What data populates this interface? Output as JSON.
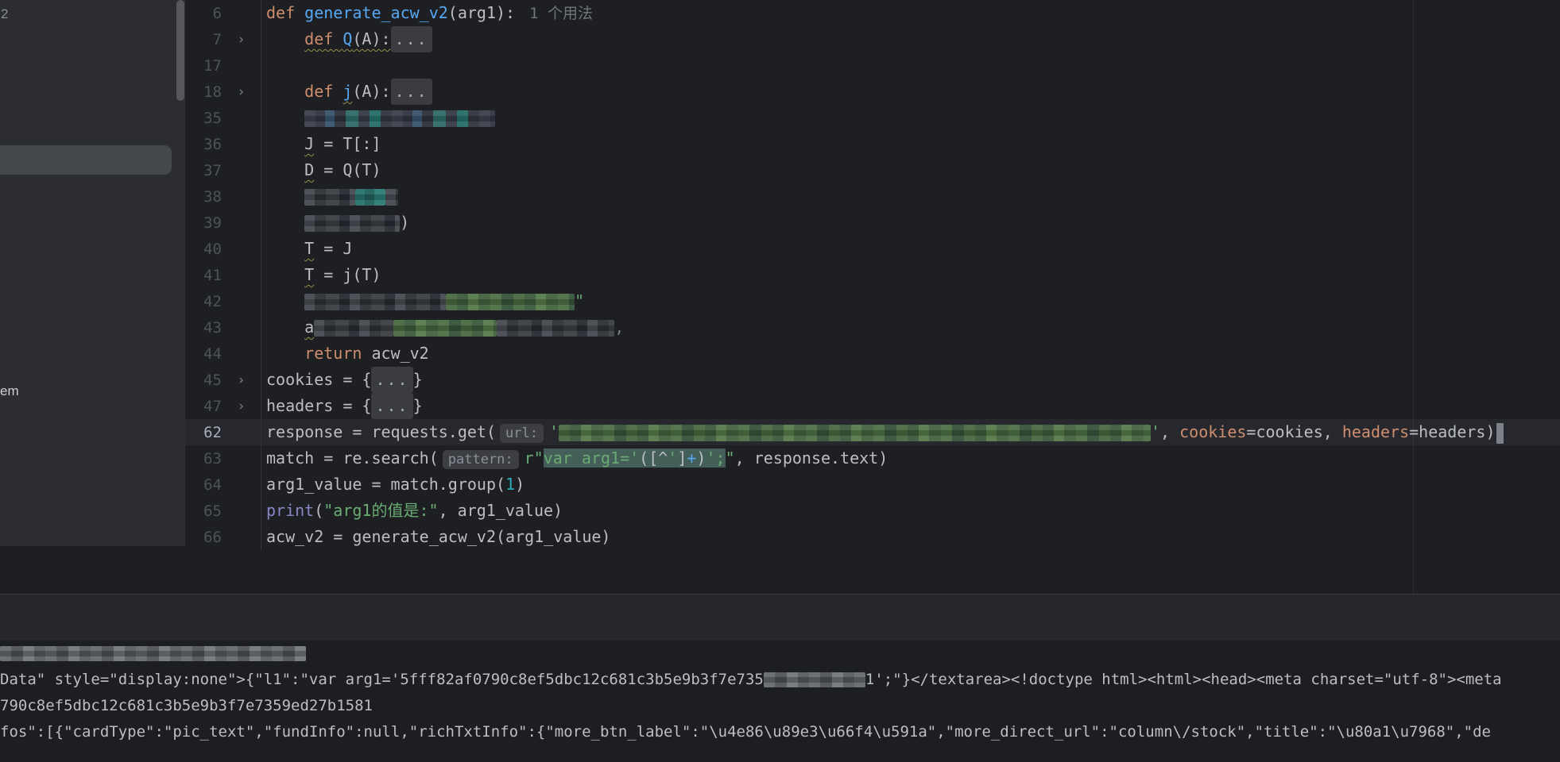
{
  "colors": {
    "editor_bg": "#1e1f22",
    "sidebar_bg": "#2b2d30",
    "current_line_bg": "#26282e",
    "keyword_orange": "#cf8e6d",
    "function_blue": "#56a8f5",
    "string_green": "#6aab73",
    "number_cyan": "#2aacb8",
    "builtin_purple": "#8888c6",
    "plain_text": "#bcbec4",
    "line_number_gray": "#4d525b",
    "selection_teal": "#445e58",
    "warning_squiggle": "#97904c"
  },
  "sidebar": {
    "top_partial_label": "2",
    "partial_item_label": "em"
  },
  "editor": {
    "usage_hint": "1 个用法",
    "lines": [
      {
        "num": "6",
        "arrow": false,
        "cur": false,
        "segs": [
          [
            "kw",
            "def "
          ],
          [
            "fn",
            "generate_acw_v2"
          ],
          [
            "pl",
            "(arg1):"
          ],
          [
            "hint",
            "1 个用法"
          ]
        ]
      },
      {
        "num": "7",
        "arrow": true,
        "cur": false,
        "segs": [
          [
            "pl",
            "    "
          ],
          [
            "kw",
            "def ",
            "sq"
          ],
          [
            "fn",
            "Q",
            "sq"
          ],
          [
            "pl",
            "(A):",
            "sq"
          ],
          [
            "fold",
            "..."
          ]
        ]
      },
      {
        "num": "17",
        "arrow": false,
        "cur": false,
        "segs": []
      },
      {
        "num": "18",
        "arrow": true,
        "cur": false,
        "segs": [
          [
            "pl",
            "    "
          ],
          [
            "kw",
            "def "
          ],
          [
            "fn",
            "j",
            "sq"
          ],
          [
            "pl",
            "(A):"
          ],
          [
            "fold",
            "..."
          ]
        ]
      },
      {
        "num": "35",
        "arrow": false,
        "cur": false,
        "segs": [
          [
            "pl",
            "    "
          ],
          [
            "mz-blue",
            240
          ]
        ]
      },
      {
        "num": "36",
        "arrow": false,
        "cur": false,
        "segs": [
          [
            "pl",
            "    "
          ],
          [
            "pl",
            "J",
            "sq"
          ],
          [
            "pl",
            " = T[:]"
          ]
        ]
      },
      {
        "num": "37",
        "arrow": false,
        "cur": false,
        "segs": [
          [
            "pl",
            "    "
          ],
          [
            "pl",
            "D",
            "sq"
          ],
          [
            "pl",
            " = Q(T)"
          ]
        ]
      },
      {
        "num": "38",
        "arrow": false,
        "cur": false,
        "segs": [
          [
            "pl",
            "    "
          ],
          [
            "mz-gray",
            64
          ],
          [
            "mz-teal",
            38
          ],
          [
            "mz-gray",
            16
          ]
        ]
      },
      {
        "num": "39",
        "arrow": false,
        "cur": false,
        "segs": [
          [
            "pl",
            "    "
          ],
          [
            "mz-gray",
            120
          ],
          [
            "pl",
            ")"
          ]
        ]
      },
      {
        "num": "40",
        "arrow": false,
        "cur": false,
        "segs": [
          [
            "pl",
            "    "
          ],
          [
            "pl",
            "T",
            "sq"
          ],
          [
            "pl",
            " = J"
          ]
        ]
      },
      {
        "num": "41",
        "arrow": false,
        "cur": false,
        "segs": [
          [
            "pl",
            "    "
          ],
          [
            "pl",
            "T",
            "sq"
          ],
          [
            "pl",
            " = j(T)"
          ]
        ]
      },
      {
        "num": "42",
        "arrow": false,
        "cur": false,
        "segs": [
          [
            "pl",
            "    "
          ],
          [
            "mz-gray",
            178
          ],
          [
            "mz-green",
            162
          ],
          [
            "str",
            "\""
          ]
        ]
      },
      {
        "num": "43",
        "arrow": false,
        "cur": false,
        "segs": [
          [
            "pl",
            "    "
          ],
          [
            "pl",
            "a",
            "sq"
          ],
          [
            "mz-gray",
            100
          ],
          [
            "mz-green",
            130
          ],
          [
            "mz-gray",
            148
          ],
          [
            "dim",
            ","
          ]
        ]
      },
      {
        "num": "44",
        "arrow": false,
        "cur": false,
        "segs": [
          [
            "pl",
            "    "
          ],
          [
            "kw",
            "return"
          ],
          [
            "pl",
            " acw_v2"
          ]
        ]
      },
      {
        "num": "45",
        "arrow": true,
        "cur": false,
        "segs": [
          [
            "pl",
            "cookies = {"
          ],
          [
            "fold",
            "..."
          ],
          [
            "pl",
            "}"
          ]
        ]
      },
      {
        "num": "47",
        "arrow": true,
        "cur": false,
        "segs": [
          [
            "pl",
            "headers = {"
          ],
          [
            "fold",
            "..."
          ],
          [
            "pl",
            "}"
          ]
        ]
      },
      {
        "num": "62",
        "arrow": false,
        "cur": true,
        "segs": [
          [
            "pl",
            "response = requests.get("
          ],
          [
            "pill",
            "url:"
          ],
          [
            "str",
            "'"
          ],
          [
            "mz-green",
            745
          ],
          [
            "str",
            "'"
          ],
          [
            "pl",
            ", "
          ],
          [
            "arg",
            "cookies"
          ],
          [
            "pl",
            "=cookies, "
          ],
          [
            "arg",
            "headers"
          ],
          [
            "pl",
            "=headers)"
          ],
          [
            "caret",
            ""
          ]
        ]
      },
      {
        "num": "63",
        "arrow": false,
        "cur": false,
        "segs": [
          [
            "pl",
            "match = re.search("
          ],
          [
            "pill",
            "pattern:"
          ],
          [
            "str",
            "r\""
          ],
          [
            "str",
            "var arg1='",
            "hl"
          ],
          [
            "pl",
            "([^",
            "hl"
          ],
          [
            "str",
            "'",
            "hl"
          ],
          [
            "pl",
            "]",
            "hl"
          ],
          [
            "fn",
            "+",
            "hl"
          ],
          [
            "pl",
            ")",
            "hl"
          ],
          [
            "str",
            "';",
            "hl"
          ],
          [
            "str",
            "\""
          ],
          [
            "pl",
            ", response.text)"
          ]
        ]
      },
      {
        "num": "64",
        "arrow": false,
        "cur": false,
        "segs": [
          [
            "pl",
            "arg1_value = match.group("
          ],
          [
            "num",
            "1"
          ],
          [
            "pl",
            ")"
          ]
        ]
      },
      {
        "num": "65",
        "arrow": false,
        "cur": false,
        "segs": [
          [
            "bi",
            "print"
          ],
          [
            "pl",
            "("
          ],
          [
            "str",
            "\"arg1的值是:\""
          ],
          [
            "pl",
            ", arg1_value)"
          ]
        ]
      },
      {
        "num": "66",
        "arrow": false,
        "cur": false,
        "segs": [
          [
            "pl",
            "acw_v2 = generate_acw_v2(arg1_value)"
          ]
        ]
      }
    ]
  },
  "console": {
    "lines": [
      [
        [
          "mz-light",
          385
        ]
      ],
      [
        [
          "t",
          "Data\" style=\"display:none\">{\"l1\":\"var arg1='5fff82af0790c8ef5dbc12c681c3b5e9b3f7e735"
        ],
        [
          "mz-light",
          128
        ],
        [
          "t",
          "1';\"}</textarea><!doctype html><html><head><meta charset=\"utf-8\"><meta"
        ]
      ],
      [
        [
          "t",
          "790c8ef5dbc12c681c3b5e9b3f7e7359ed27b1581"
        ]
      ],
      [
        [
          "t",
          "fos\":[{\"cardType\":\"pic_text\",\"fundInfo\":null,\"richTxtInfo\":{\"more_btn_label\":\"\\u4e86\\u89e3\\u66f4\\u591a\",\"more_direct_url\":\"column\\/stock\",\"title\":\"\\u80a1\\u7968\",\"de"
        ]
      ]
    ]
  }
}
